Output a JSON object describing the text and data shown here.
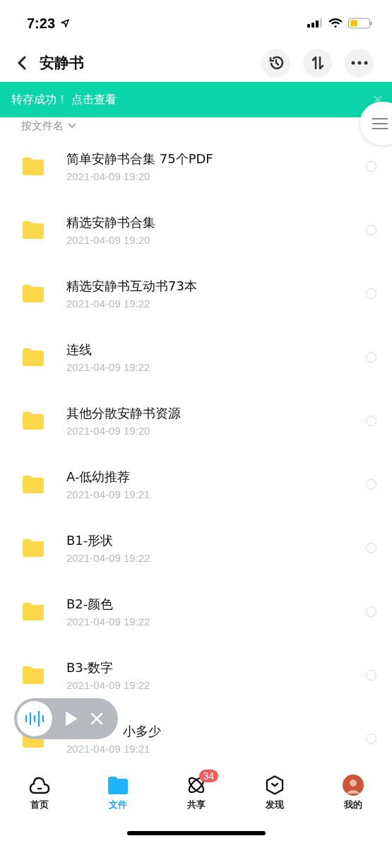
{
  "status_bar": {
    "time": "7:23"
  },
  "header": {
    "title": "安静书"
  },
  "banner": {
    "message": "转存成功！ 点击查看"
  },
  "sort": {
    "label": "按文件名"
  },
  "files": [
    {
      "kind": "folder",
      "name": "简单安静书合集 75个PDF",
      "date": "2021-04-09 19:20",
      "selected": false
    },
    {
      "kind": "folder",
      "name": "精选安静书合集",
      "date": "2021-04-09 19:20",
      "selected": false
    },
    {
      "kind": "folder",
      "name": "精选安静书互动书73本",
      "date": "2021-04-09 19:22",
      "selected": false
    },
    {
      "kind": "folder",
      "name": "连线",
      "date": "2021-04-09 19:22",
      "selected": false
    },
    {
      "kind": "folder",
      "name": "其他分散安静书资源",
      "date": "2021-04-09 19:20",
      "selected": false
    },
    {
      "kind": "folder",
      "name": "A-低幼推荐",
      "date": "2021-04-09 19:21",
      "selected": false
    },
    {
      "kind": "folder",
      "name": "B1-形状",
      "date": "2021-04-09 19:22",
      "selected": false
    },
    {
      "kind": "folder",
      "name": "B2-颜色",
      "date": "2021-04-09 19:22",
      "selected": false
    },
    {
      "kind": "folder",
      "name": "B3-数字",
      "date": "2021-04-09 19:22",
      "selected": false
    },
    {
      "kind": "covered",
      "name": "小多少",
      "date": "2021-04-09 19:21",
      "selected": false
    }
  ],
  "tabs": [
    {
      "kind": "home",
      "label": "首页",
      "selected": false
    },
    {
      "kind": "files",
      "label": "文件",
      "selected": true
    },
    {
      "kind": "share",
      "label": "共享",
      "selected": false,
      "badge": "34"
    },
    {
      "kind": "discover",
      "label": "发现",
      "selected": false
    },
    {
      "kind": "me",
      "label": "我的",
      "selected": false
    }
  ]
}
